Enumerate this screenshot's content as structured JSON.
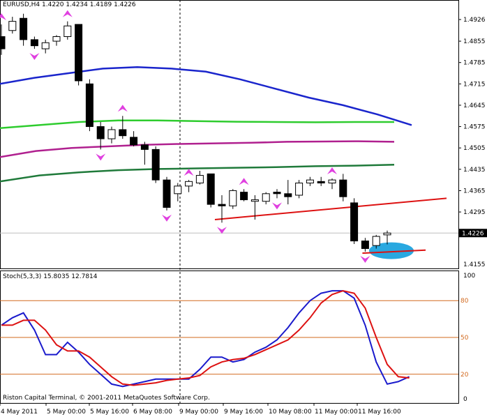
{
  "chart_data": [
    {
      "type": "candlestick",
      "symbol_header": "EURUSD,H4",
      "ohlc_header": [
        "1.4220",
        "1.4234",
        "1.4189",
        "1.4226"
      ],
      "ylim": [
        1.411,
        1.499
      ],
      "price_ticks": [
        "1.4926",
        "1.4855",
        "1.4785",
        "1.4715",
        "1.4645",
        "1.4575",
        "1.4505",
        "1.4435",
        "1.4365",
        "1.4295"
      ],
      "bottom_tick": "1.4155",
      "current_price": "1.4226",
      "candles": [
        {
          "o": 1.487,
          "h": 1.491,
          "l": 1.481,
          "c": 1.483
        },
        {
          "o": 1.489,
          "h": 1.4935,
          "l": 1.488,
          "c": 1.492
        },
        {
          "o": 1.493,
          "h": 1.4945,
          "l": 1.484,
          "c": 1.486
        },
        {
          "o": 1.486,
          "h": 1.487,
          "l": 1.483,
          "c": 1.484
        },
        {
          "o": 1.483,
          "h": 1.486,
          "l": 1.4815,
          "c": 1.485
        },
        {
          "o": 1.4855,
          "h": 1.4875,
          "l": 1.484,
          "c": 1.487
        },
        {
          "o": 1.487,
          "h": 1.492,
          "l": 1.486,
          "c": 1.4905
        },
        {
          "o": 1.491,
          "h": 1.491,
          "l": 1.471,
          "c": 1.4725
        },
        {
          "o": 1.4715,
          "h": 1.473,
          "l": 1.456,
          "c": 1.4575
        },
        {
          "o": 1.4575,
          "h": 1.459,
          "l": 1.45,
          "c": 1.4535
        },
        {
          "o": 1.4535,
          "h": 1.4575,
          "l": 1.452,
          "c": 1.4565
        },
        {
          "o": 1.4565,
          "h": 1.461,
          "l": 1.4535,
          "c": 1.4545
        },
        {
          "o": 1.454,
          "h": 1.456,
          "l": 1.451,
          "c": 1.4515
        },
        {
          "o": 1.4515,
          "h": 1.4525,
          "l": 1.445,
          "c": 1.45
        },
        {
          "o": 1.45,
          "h": 1.451,
          "l": 1.439,
          "c": 1.44
        },
        {
          "o": 1.44,
          "h": 1.441,
          "l": 1.43,
          "c": 1.431
        },
        {
          "o": 1.4355,
          "h": 1.439,
          "l": 1.433,
          "c": 1.438
        },
        {
          "o": 1.438,
          "h": 1.44,
          "l": 1.436,
          "c": 1.4395
        },
        {
          "o": 1.439,
          "h": 1.443,
          "l": 1.4385,
          "c": 1.4415
        },
        {
          "o": 1.442,
          "h": 1.442,
          "l": 1.431,
          "c": 1.432
        },
        {
          "o": 1.432,
          "h": 1.435,
          "l": 1.426,
          "c": 1.4315
        },
        {
          "o": 1.4315,
          "h": 1.437,
          "l": 1.4305,
          "c": 1.4365
        },
        {
          "o": 1.436,
          "h": 1.437,
          "l": 1.433,
          "c": 1.4335
        },
        {
          "o": 1.433,
          "h": 1.435,
          "l": 1.427,
          "c": 1.4335
        },
        {
          "o": 1.433,
          "h": 1.436,
          "l": 1.432,
          "c": 1.4355
        },
        {
          "o": 1.436,
          "h": 1.437,
          "l": 1.434,
          "c": 1.4355
        },
        {
          "o": 1.4355,
          "h": 1.44,
          "l": 1.432,
          "c": 1.4345
        },
        {
          "o": 1.435,
          "h": 1.44,
          "l": 1.434,
          "c": 1.439
        },
        {
          "o": 1.439,
          "h": 1.441,
          "l": 1.438,
          "c": 1.44
        },
        {
          "o": 1.4395,
          "h": 1.441,
          "l": 1.438,
          "c": 1.439
        },
        {
          "o": 1.439,
          "h": 1.4405,
          "l": 1.437,
          "c": 1.44
        },
        {
          "o": 1.44,
          "h": 1.442,
          "l": 1.433,
          "c": 1.4345
        },
        {
          "o": 1.4325,
          "h": 1.434,
          "l": 1.419,
          "c": 1.42
        },
        {
          "o": 1.42,
          "h": 1.421,
          "l": 1.4165,
          "c": 1.4175
        },
        {
          "o": 1.4185,
          "h": 1.422,
          "l": 1.4175,
          "c": 1.4215
        },
        {
          "o": 1.422,
          "h": 1.4234,
          "l": 1.4189,
          "c": 1.4226
        }
      ],
      "moving_averages": [
        {
          "color": "#1a25cc",
          "values": [
            1.4715,
            1.4735,
            1.475,
            1.4765,
            1.477,
            1.4765,
            1.4755,
            1.473,
            1.47,
            1.467,
            1.4645,
            1.4615,
            1.458
          ]
        },
        {
          "color": "#2ecc2e",
          "values": [
            1.457,
            1.458,
            1.459,
            1.4595,
            1.4595,
            1.4593,
            1.4591,
            1.459,
            1.4589,
            1.459,
            1.459
          ]
        },
        {
          "color": "#b0208f",
          "values": [
            1.4475,
            1.4495,
            1.4505,
            1.451,
            1.4515,
            1.4518,
            1.452,
            1.4522,
            1.4525,
            1.4526,
            1.4527,
            1.4525
          ]
        },
        {
          "color": "#1f7a3a",
          "values": [
            1.4395,
            1.4415,
            1.4425,
            1.4432,
            1.4436,
            1.4438,
            1.444,
            1.4442,
            1.4445,
            1.4447,
            1.445
          ]
        }
      ],
      "fractals_up": [
        0,
        6,
        11,
        17,
        22,
        30
      ],
      "fractals_down": [
        3,
        9,
        15,
        20,
        25,
        33
      ],
      "trendline": {
        "x1": 20,
        "y1": 1.427,
        "x2": 40,
        "y2": 1.434
      },
      "support_line": {
        "x1": 33,
        "y1": 1.416,
        "x2": 38,
        "y2": 1.417
      },
      "time_labels": [
        "4 May 2011",
        "5 May 00:00",
        "5 May 16:00",
        "6 May 08:00",
        "9 May 00:00",
        "9 May 16:00",
        "10 May 08:00",
        "11 May 00:00",
        "11 May 16:00"
      ]
    },
    {
      "type": "line",
      "indicator_header": [
        "Stoch(5,3,3)",
        "15.8035",
        "12.7814"
      ],
      "ylim": [
        0,
        100
      ],
      "level_labels": [
        "80",
        "50",
        "20"
      ],
      "axis_ticks": [
        "100",
        "0"
      ],
      "series": [
        {
          "color": "#1a1acc",
          "values": [
            60,
            66,
            70,
            56,
            36,
            36,
            46,
            38,
            28,
            20,
            12,
            10,
            12,
            14,
            16,
            16,
            16,
            16,
            24,
            34,
            34,
            30,
            32,
            38,
            42,
            48,
            58,
            70,
            80,
            86,
            88,
            88,
            82,
            60,
            30,
            12,
            14,
            18
          ]
        },
        {
          "color": "#dd1111",
          "values": [
            60,
            60,
            64,
            64,
            56,
            44,
            39,
            39,
            34,
            26,
            18,
            12,
            11,
            12,
            13,
            15,
            16,
            17,
            19,
            26,
            30,
            32,
            33,
            36,
            40,
            44,
            48,
            56,
            66,
            78,
            85,
            88,
            86,
            74,
            50,
            28,
            18,
            17
          ]
        }
      ]
    }
  ],
  "footer": "Riston Capital Terminal, © 2001-2011 MetaQuotes Software Corp."
}
